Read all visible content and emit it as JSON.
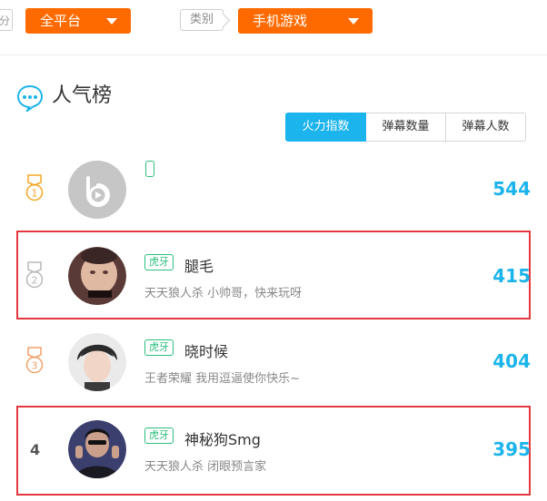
{
  "filters": {
    "platform": {
      "label": "全平台"
    },
    "category": {
      "tag": "类别",
      "value": "手机游戏"
    },
    "cut_tag_char": "分"
  },
  "section": {
    "title": "人气榜"
  },
  "tabs": [
    {
      "label": "火力指数",
      "active": true
    },
    {
      "label": "弹幕数量",
      "active": false
    },
    {
      "label": "弹幕人数",
      "active": false
    }
  ],
  "ranking": [
    {
      "rank": "1",
      "platform": "",
      "name": "",
      "desc": "",
      "count": "544",
      "medal": "gold"
    },
    {
      "rank": "2",
      "platform": "虎牙",
      "name": "腿毛",
      "desc": "天天狼人杀 小帅哥，快来玩呀",
      "count": "415",
      "medal": "silver"
    },
    {
      "rank": "3",
      "platform": "虎牙",
      "name": "晓时候",
      "desc": "王者荣耀 我用逗逼使你快乐~",
      "count": "404",
      "medal": "bronze"
    },
    {
      "rank": "4",
      "platform": "虎牙",
      "name": "神秘狗Smg",
      "desc": "天天狼人杀 闭眼预言家",
      "count": "395",
      "medal": ""
    }
  ],
  "colors": {
    "accent_orange": "#ff6a00",
    "accent_blue": "#1cb4ec",
    "highlight_red": "#e5383e",
    "badge_green": "#2bbf7c"
  }
}
